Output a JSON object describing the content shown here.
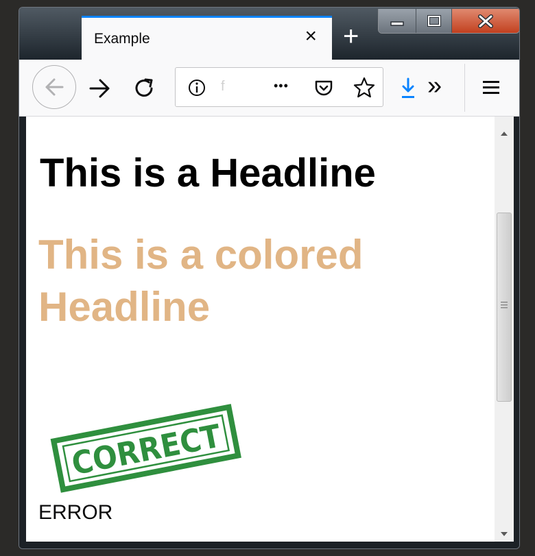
{
  "tab": {
    "title": "Example"
  },
  "icons": {
    "close": "×",
    "new_tab": "+",
    "more": "•••",
    "overflow": "»",
    "menu": "≡"
  },
  "page": {
    "headline": "This is a Headline",
    "colored_headline": "This is a colored Headline",
    "colored_headline_color": "#e1b585",
    "stamp_text": "CORRECT",
    "stamp_color": "#2f8f3e",
    "error_text": "ERROR"
  },
  "colors": {
    "accent": "#0a84ff",
    "download": "#0a84ff"
  }
}
